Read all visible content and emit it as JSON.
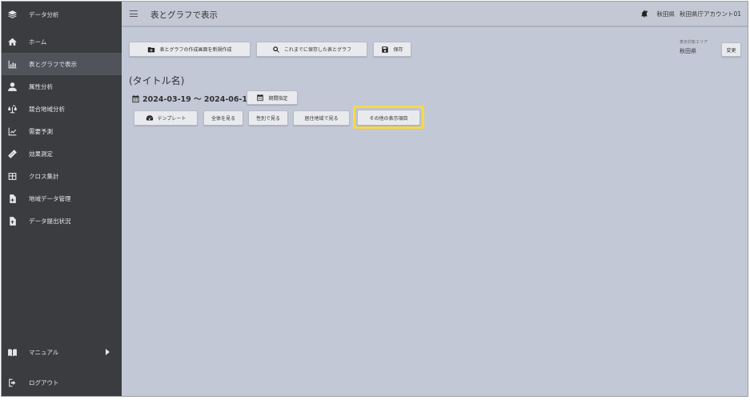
{
  "sidebar": {
    "items": [
      {
        "label": "データ分析",
        "icon": "layers-icon"
      },
      {
        "label": "ホーム",
        "icon": "home-icon"
      },
      {
        "label": "表とグラフで表示",
        "icon": "bar-chart-icon",
        "active": true
      },
      {
        "label": "属性分析",
        "icon": "person-icon"
      },
      {
        "label": "競合地域分析",
        "icon": "scale-icon"
      },
      {
        "label": "需要予測",
        "icon": "trend-icon"
      },
      {
        "label": "効果測定",
        "icon": "ruler-icon"
      },
      {
        "label": "クロス集計",
        "icon": "table-icon"
      },
      {
        "label": "地域データ管理",
        "icon": "file-add-icon"
      },
      {
        "label": "データ提出状況",
        "icon": "file-upload-icon"
      }
    ],
    "manual": {
      "label": "マニュアル",
      "icon": "book-icon"
    },
    "logout": {
      "label": "ログアウト",
      "icon": "logout-icon"
    }
  },
  "header": {
    "title": "表とグラフで表示",
    "prefecture": "秋田県",
    "account": "秋田県庁アカウント01"
  },
  "toolbar": {
    "new_label": "表とグラフの作成画面を新規作成",
    "saved_label": "これまでに保存した表とグラフ",
    "save_label": "保存"
  },
  "area": {
    "caption": "表示対象エリア",
    "value": "秋田県",
    "change_label": "変更"
  },
  "report": {
    "title": "(タイトル名)",
    "period": "2024-03-19 ～ 2024-06-19",
    "period_button": "期間指定"
  },
  "views": {
    "template": "テンプレート",
    "all": "全体を見る",
    "gender": "性別で見る",
    "residence": "居住地域で見る",
    "other": "その他の表示項目"
  },
  "colors": {
    "sidebar": "#3a3c40",
    "main": "#c2c8d6",
    "highlight": "#f6d84a"
  }
}
